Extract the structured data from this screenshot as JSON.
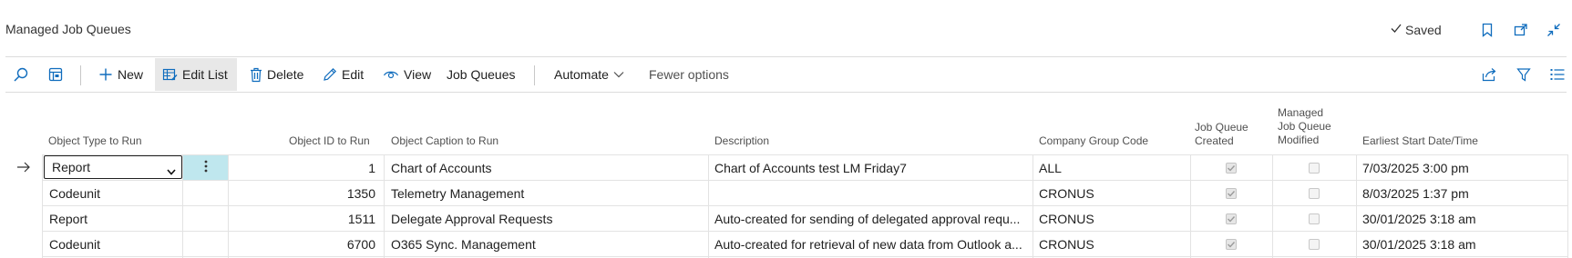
{
  "window": {
    "title": "Managed Job Queues",
    "saved_label": "Saved"
  },
  "actions": {
    "new_label": "New",
    "edit_list_label": "Edit List",
    "delete_label": "Delete",
    "edit_label": "Edit",
    "view_label": "View",
    "job_queues_label": "Job Queues",
    "automate_label": "Automate",
    "fewer_options_label": "Fewer options"
  },
  "table": {
    "headers": {
      "object_type": "Object Type to Run",
      "object_id": "Object ID to Run",
      "object_caption": "Object Caption to Run",
      "description": "Description",
      "company_group": "Company Group Code",
      "jq_created_1": "Job Queue",
      "jq_created_2": "Created",
      "managed_1": "Managed",
      "managed_2": "Job Queue",
      "managed_3": "Modified",
      "earliest_start": "Earliest Start Date/Time"
    },
    "rows": [
      {
        "object_type": "Report",
        "object_id": "1",
        "caption": "Chart of Accounts",
        "description": "Chart of Accounts test LM Friday7",
        "company_group": "ALL",
        "jq_created": true,
        "managed_modified": false,
        "earliest_start": "7/03/2025 3:00 pm"
      },
      {
        "object_type": "Codeunit",
        "object_id": "1350",
        "caption": "Telemetry Management",
        "description": "",
        "company_group": "CRONUS",
        "jq_created": true,
        "managed_modified": false,
        "earliest_start": "8/03/2025 1:37 pm"
      },
      {
        "object_type": "Report",
        "object_id": "1511",
        "caption": "Delegate Approval Requests",
        "description": "Auto-created for sending of delegated approval requ...",
        "company_group": "CRONUS",
        "jq_created": true,
        "managed_modified": false,
        "earliest_start": "30/01/2025 3:18 am"
      },
      {
        "object_type": "Codeunit",
        "object_id": "6700",
        "caption": "O365 Sync. Management",
        "description": "Auto-created for retrieval of new data from Outlook a...",
        "company_group": "CRONUS",
        "jq_created": true,
        "managed_modified": false,
        "earliest_start": "30/01/2025 3:18 am"
      }
    ],
    "select_options": [
      "Report"
    ]
  },
  "icons": {
    "search": "search-icon",
    "filter_pane": "filter-pane-icon",
    "new": "plus-icon",
    "edit_list": "edit-list-icon",
    "delete": "trash-icon",
    "edit": "pencil-icon",
    "view": "eye-icon",
    "share": "share-icon",
    "filter": "filter-icon",
    "list": "list-icon",
    "bookmark": "bookmark-icon",
    "open_new": "open-in-new-window-icon",
    "collapse": "collapse-icon",
    "row_indicator": "arrow-right-icon",
    "more": "ellipsis-vertical-icon"
  },
  "colors": {
    "accent": "#0f6cbd",
    "selected_cell": "#bfe7ee",
    "active_action": "#e8e8e8"
  }
}
